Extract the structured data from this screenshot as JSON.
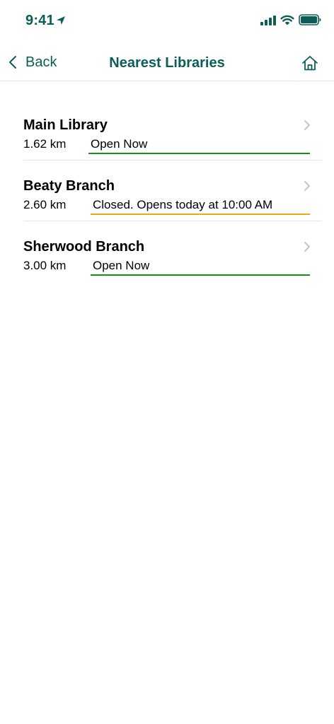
{
  "status_bar": {
    "time": "9:41"
  },
  "nav": {
    "back_label": "Back",
    "title": "Nearest Libraries"
  },
  "libraries": [
    {
      "name": "Main Library",
      "distance": "1.62 km",
      "status": "Open Now",
      "state": "open"
    },
    {
      "name": "Beaty Branch",
      "distance": "2.60 km",
      "status": "Closed. Opens today at 10:00 AM",
      "state": "closed"
    },
    {
      "name": "Sherwood Branch",
      "distance": "3.00 km",
      "status": "Open Now",
      "state": "open"
    }
  ],
  "colors": {
    "brand_teal": "#0b5e58",
    "open_green": "#1e8a1e",
    "closed_amber": "#eea814",
    "separator": "#e4e4e4",
    "chevron_gray": "#c4c4c6"
  },
  "icons": {
    "location": "location-arrow-icon",
    "signal": "cellular-signal-icon",
    "wifi": "wifi-icon",
    "battery": "battery-icon",
    "back": "chevron-left-icon",
    "home": "home-icon",
    "row": "chevron-right-icon"
  }
}
